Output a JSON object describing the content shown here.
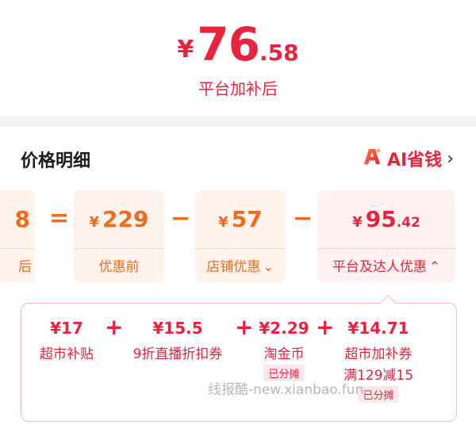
{
  "price": {
    "currency": "¥",
    "integer": "76",
    "decimal": ".58",
    "caption": "平台加补后"
  },
  "section": {
    "title": "价格明细",
    "ai_label": "AI省钱",
    "ai_icon": "sparkle-a-icon",
    "arrow": "›"
  },
  "formula": {
    "result_partial_value": "8",
    "result_partial_label": "后",
    "equals": "=",
    "minus": "−",
    "original": {
      "currency": "¥",
      "value": "229",
      "label": "优惠前"
    },
    "store": {
      "currency": "¥",
      "value": "57",
      "label": "店铺优惠",
      "chevron": "⌄"
    },
    "platform": {
      "currency": "¥",
      "value": "95",
      "decimal": ".42",
      "label": "平台及达人优惠",
      "chevron": "⌃"
    }
  },
  "details": {
    "plus": "+",
    "items": [
      {
        "amount": "¥17",
        "name": "超市补贴"
      },
      {
        "amount": "¥15.5",
        "name": "9折直播折扣券"
      },
      {
        "amount": "¥2.29",
        "name": "淘金币",
        "tag": "已分摊"
      },
      {
        "amount": "¥14.71",
        "name": "超市加补券",
        "note": "满129减15",
        "tag": "已分摊"
      }
    ]
  },
  "watermark": "线报酷-new.xianbao.fun",
  "colors": {
    "accent_red": "#e8233e",
    "accent_orange": "#f26a1b"
  }
}
